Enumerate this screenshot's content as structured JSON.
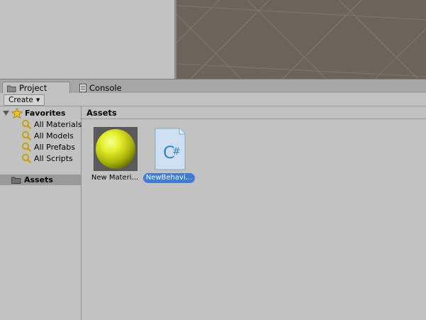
{
  "tabs": [
    {
      "label": "Project",
      "icon": "folder-icon",
      "active": true
    },
    {
      "label": "Console",
      "icon": "console-icon",
      "active": false
    }
  ],
  "toolbar": {
    "create_label": "Create"
  },
  "favorites": {
    "label": "Favorites",
    "items": [
      {
        "label": "All Materials"
      },
      {
        "label": "All Models"
      },
      {
        "label": "All Prefabs"
      },
      {
        "label": "All Scripts"
      }
    ]
  },
  "tree": {
    "assets_label": "Assets"
  },
  "content": {
    "breadcrumb": "Assets",
    "assets": [
      {
        "label": "New Materi...",
        "icon": "material-sphere-icon",
        "selected": false
      },
      {
        "label": "NewBehavi...",
        "icon": "csharp-script-icon",
        "selected": true
      }
    ]
  },
  "colors": {
    "scene_background": "#6b645b",
    "selection": "#3d7dd9",
    "panel_background": "#c2c2c2"
  }
}
